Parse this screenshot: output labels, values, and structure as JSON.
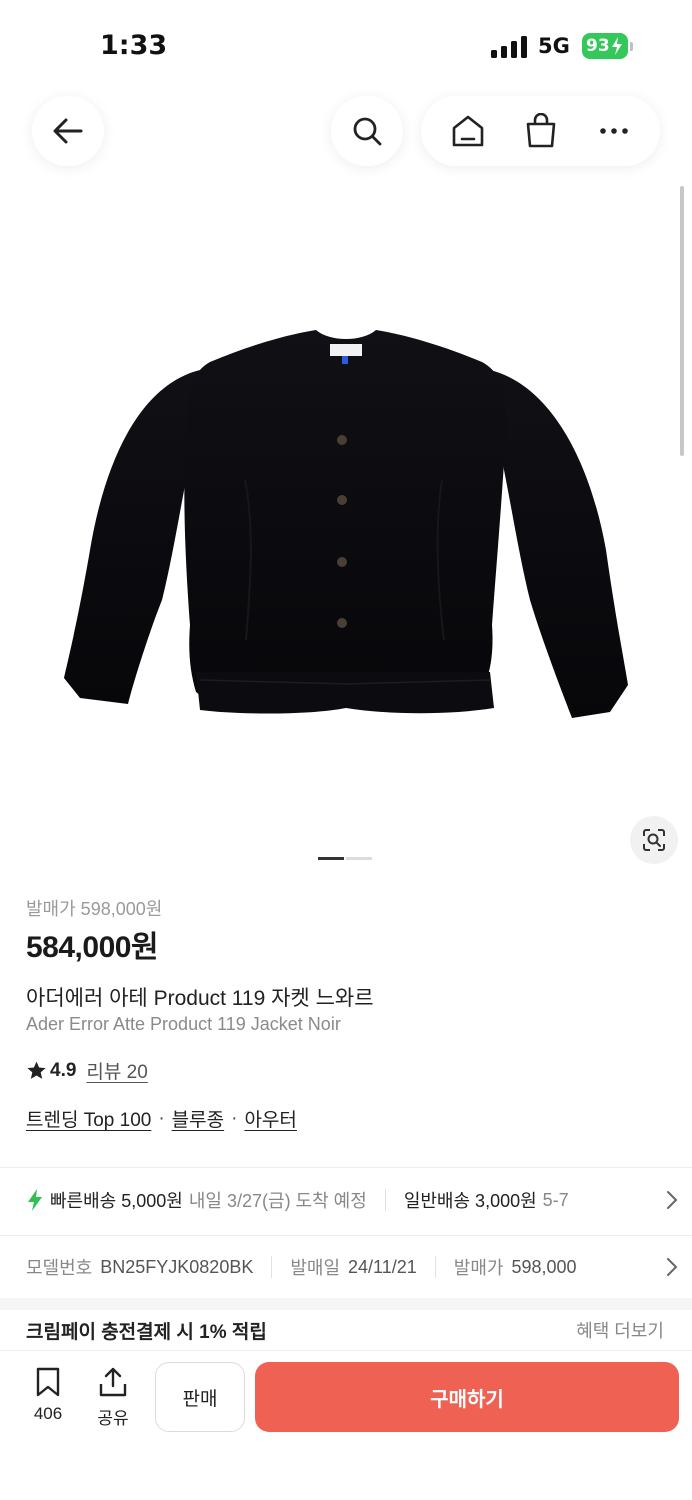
{
  "status_bar": {
    "time": "1:33",
    "network": "5G",
    "battery": "93"
  },
  "nav": {
    "back": "arrow-left-icon",
    "search": "search-icon",
    "home": "home-icon",
    "bag": "shopping-bag-icon",
    "more": "more-horizontal-icon"
  },
  "gallery": {
    "total_pages": 2,
    "current_page": 1
  },
  "product": {
    "release_price_label": "발매가 598,000원",
    "price": "584,000원",
    "name_ko": "아더에러 아테 Product 119 자켓 느와르",
    "name_en": "Ader Error Atte Product 119 Jacket Noir",
    "rating": "4.9",
    "review_label": "리뷰 20",
    "tags": [
      "트렌딩 Top 100",
      "블루종",
      "아우터"
    ]
  },
  "delivery": {
    "fast_label": "빠른배송 5,000원",
    "fast_eta": "내일 3/27(금) 도착 예정",
    "normal_label": "일반배송 3,000원",
    "normal_eta": "5-7"
  },
  "specs": [
    {
      "key": "모델번호",
      "value": "BN25FYJK0820BK"
    },
    {
      "key": "발매일",
      "value": "24/11/21"
    },
    {
      "key": "발매가",
      "value": "598,000"
    }
  ],
  "benefit": {
    "title": "크림페이 충전결제 시 1% 적립",
    "more": "혜택 더보기"
  },
  "bottom_bar": {
    "bookmark_count": "406",
    "share_label": "공유",
    "sell_label": "판매",
    "buy_label": "구매하기"
  },
  "colors": {
    "accent": "#ef6253",
    "fast_delivery": "#2ec152",
    "battery": "#34c759"
  }
}
